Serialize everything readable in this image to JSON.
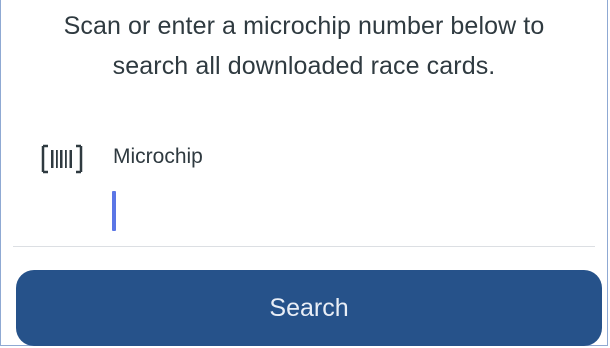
{
  "instructions": {
    "line1": "Scan or enter a microchip number below to",
    "line2": "search all downloaded race cards."
  },
  "microchip": {
    "icon": "barcode-scan-icon",
    "label": "Microchip",
    "value": "",
    "caret_color": "#5b76e6"
  },
  "search_button": {
    "label": "Search",
    "color": "#26528a"
  }
}
